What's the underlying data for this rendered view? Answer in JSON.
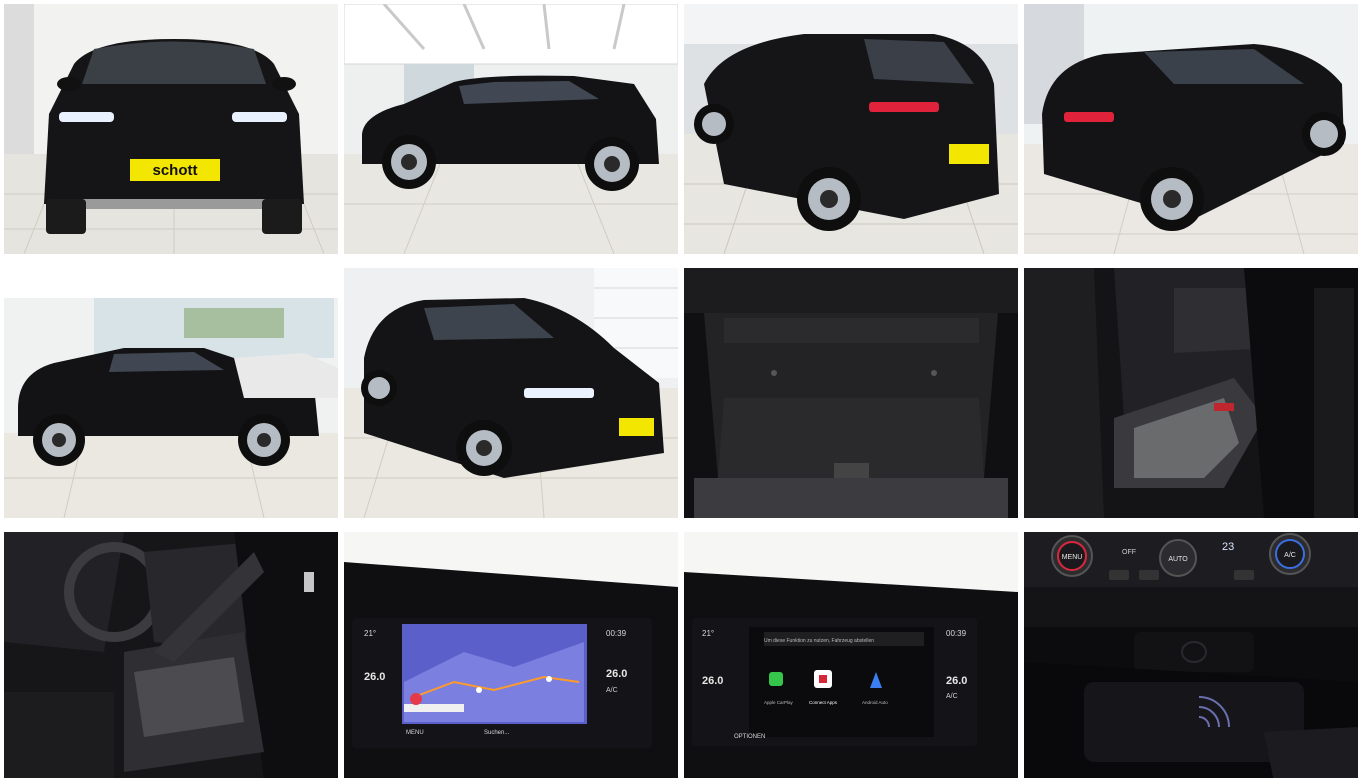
{
  "gallery": {
    "plate_text": "schott",
    "infotainment": {
      "temp_outside": "21°",
      "clock": "00:39",
      "temp_left": "26.0",
      "temp_right": "26.0",
      "ac_label": "A/C",
      "menu_label": "MENU",
      "search_label": "Suchen...",
      "options_label": "OPTIONEN",
      "apps": [
        "Apple CarPlay",
        "Connect Apps",
        "Android Auto"
      ],
      "notice_text": "Um diese Funktion zu nutzen, Fahrzeug abstellen"
    },
    "climate": {
      "menu_label": "MENU",
      "auto_label": "AUTO",
      "ac_label": "A/C",
      "off_label": "OFF",
      "temp_display": "23"
    }
  }
}
